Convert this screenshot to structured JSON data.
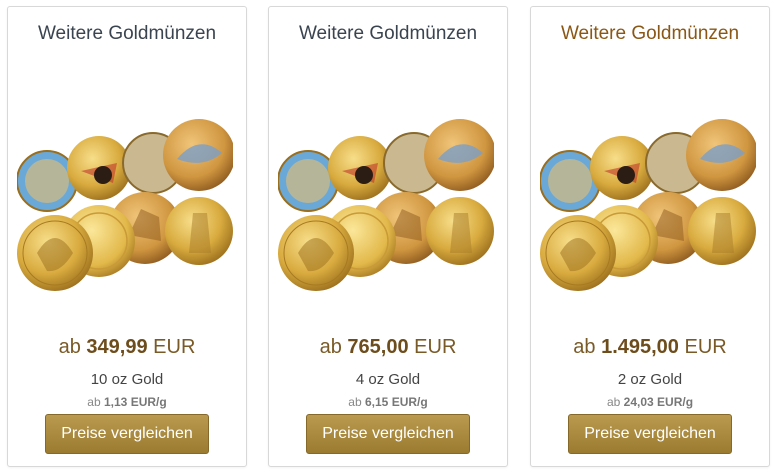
{
  "cards": [
    {
      "title": "Weitere Goldmünzen",
      "price_prefix": "ab",
      "price_value": "349,99",
      "price_currency": "EUR",
      "weight": "10 oz Gold",
      "per_gram_prefix": "ab",
      "per_gram_value": "1,13 EUR/g",
      "button_label": "Preise vergleichen"
    },
    {
      "title": "Weitere Goldmünzen",
      "price_prefix": "ab",
      "price_value": "765,00",
      "price_currency": "EUR",
      "weight": "4 oz Gold",
      "per_gram_prefix": "ab",
      "per_gram_value": "6,15 EUR/g",
      "button_label": "Preise vergleichen"
    },
    {
      "title": "Weitere Goldmünzen",
      "price_prefix": "ab",
      "price_value": "1.495,00",
      "price_currency": "EUR",
      "weight": "2 oz Gold",
      "per_gram_prefix": "ab",
      "per_gram_value": "24,03 EUR/g",
      "button_label": "Preise vergleichen"
    }
  ],
  "colors": {
    "title": "#3a4450",
    "title_active": "#8a5714",
    "price": "#6e4d1c",
    "button": "#a8893e"
  }
}
